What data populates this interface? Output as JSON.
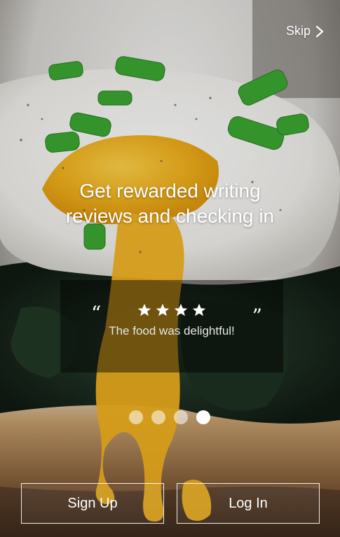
{
  "onboarding": {
    "skip_label": "Skip",
    "headline_line1": "Get rewarded writing",
    "headline_line2": "reviews and checking in",
    "review": {
      "rating": 4,
      "text": "The food was delightful!",
      "quote_open": "“",
      "quote_close": "”"
    },
    "pagination": {
      "total": 4,
      "active_index": 3
    },
    "buttons": {
      "signup_label": "Sign Up",
      "login_label": "Log In"
    }
  },
  "colors": {
    "text": "#ffffff",
    "card_bg": "rgba(0,0,0,0.45)",
    "egg_yolk": "#f2b21d",
    "greens": "#3da832",
    "bread": "#b88a56"
  },
  "icons": {
    "skip": "chevron-right-icon",
    "rating": "star-icon"
  }
}
